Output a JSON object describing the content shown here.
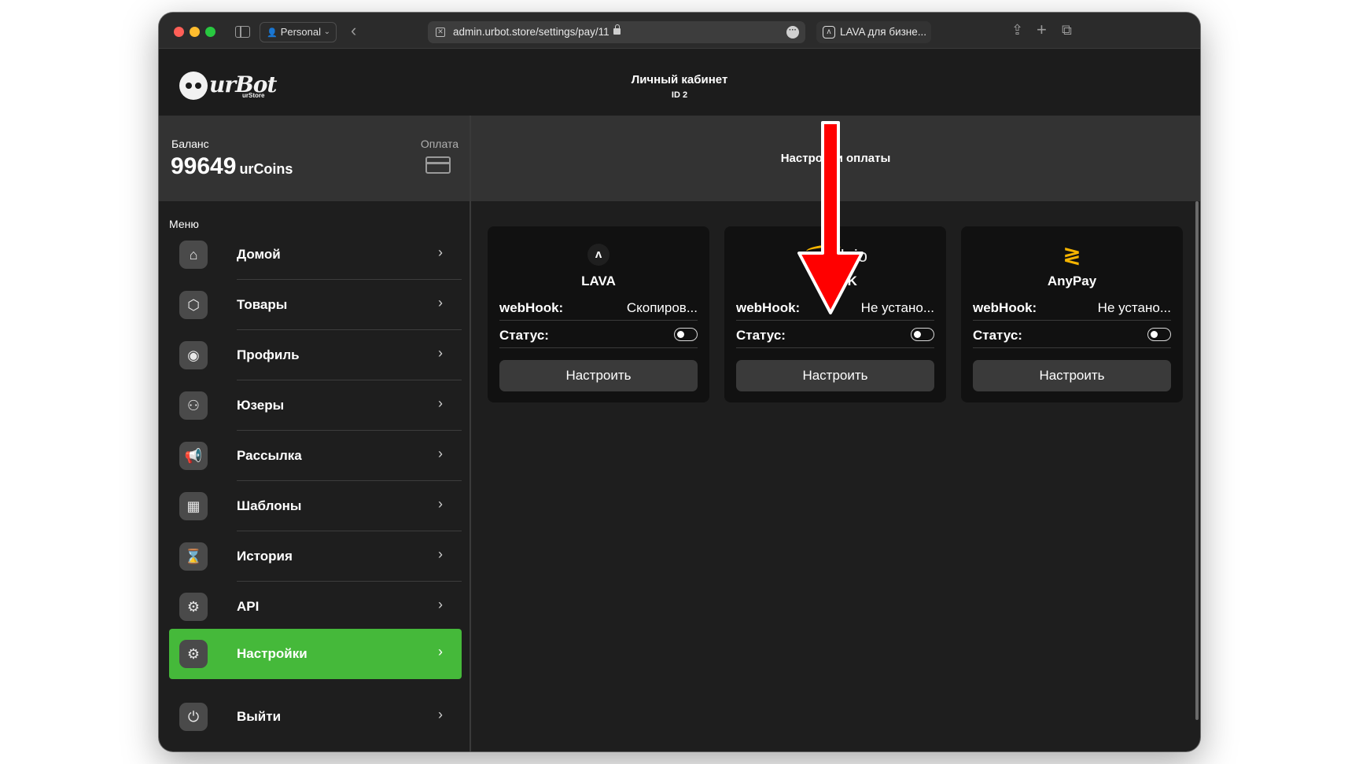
{
  "browser": {
    "profile_label": "Personal",
    "url": "admin.urbot.store/settings/pay/11",
    "tab2_title": "LAVA для бизне..."
  },
  "header": {
    "logo_text": "urBot",
    "logo_sub": "urStore",
    "title": "Личный кабинет",
    "id": "ID 2"
  },
  "balance": {
    "label": "Баланс",
    "amount": "99649",
    "unit": "urCoins",
    "pay_label": "Оплата"
  },
  "settings": {
    "title": "Настройки оплаты"
  },
  "menu": {
    "label": "Меню",
    "items": [
      {
        "label": "Домой",
        "icon": "home-icon"
      },
      {
        "label": "Товары",
        "icon": "box-icon"
      },
      {
        "label": "Профиль",
        "icon": "profile-icon"
      },
      {
        "label": "Юзеры",
        "icon": "users-icon"
      },
      {
        "label": "Рассылка",
        "icon": "megaphone-icon"
      },
      {
        "label": "Шаблоны",
        "icon": "grid-icon"
      },
      {
        "label": "История",
        "icon": "hourglass-icon"
      },
      {
        "label": "API",
        "icon": "chip-icon"
      },
      {
        "label": "Настройки",
        "icon": "gear-icon",
        "active": true
      },
      {
        "label": "Выйти",
        "icon": "logout-icon"
      }
    ]
  },
  "providers": [
    {
      "name": "LAVA",
      "webhook_label": "webHook:",
      "webhook_value": "Скопиров...",
      "status_label": "Статус:",
      "status_on": false,
      "button": "Настроить"
    },
    {
      "name": "PayOK",
      "logo_text": "payok.io",
      "webhook_label": "webHook:",
      "webhook_value": "Не устано...",
      "status_label": "Статус:",
      "status_on": false,
      "button": "Настроить"
    },
    {
      "name": "AnyPay",
      "webhook_label": "webHook:",
      "webhook_value": "Не устано...",
      "status_label": "Статус:",
      "status_on": false,
      "button": "Настроить"
    }
  ],
  "colors": {
    "accent_green": "#45b93a",
    "annotation_red": "#ff0000",
    "anypay_yellow": "#f5b400"
  }
}
